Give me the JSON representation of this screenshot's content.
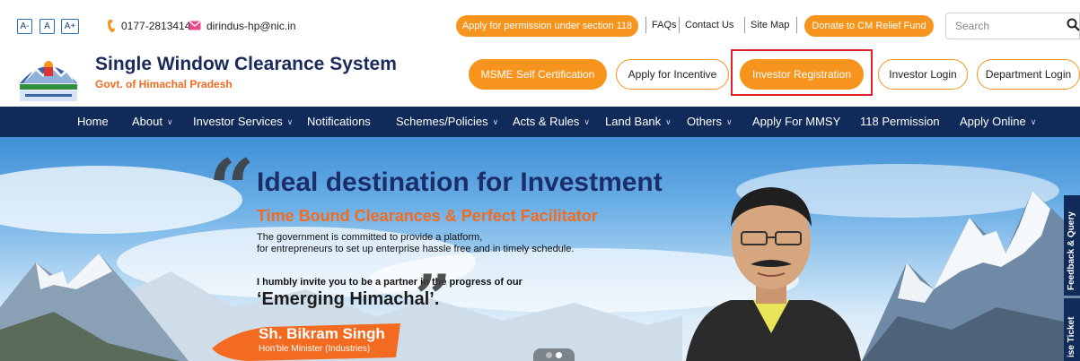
{
  "topbar": {
    "font_small": "A-",
    "font_normal": "A",
    "font_large": "A+",
    "phone": "0177-2813414",
    "email": "dirindus-hp@nic.in",
    "apply_permission": "Apply for permission under section 118",
    "faqs": "FAQs",
    "contact": "Contact Us",
    "sitemap": "Site Map",
    "donate": "Donate to CM Relief Fund",
    "search_placeholder": "Search"
  },
  "header": {
    "title": "Single Window Clearance System",
    "subtitle": "Govt. of Himachal Pradesh",
    "buttons": {
      "msme": "MSME Self Certification",
      "incentive": "Apply for Incentive",
      "investor_registration": "Investor Registration",
      "investor_login": "Investor Login",
      "department_login": "Department Login"
    }
  },
  "nav": {
    "home": "Home",
    "about": "About",
    "investor_services": "Investor Services",
    "notifications": "Notifications",
    "schemes": "Schemes/Policies",
    "acts": "Acts & Rules",
    "land_bank": "Land Bank",
    "others": "Others",
    "mmsy": "Apply For MMSY",
    "permission_118": "118 Permission",
    "apply_online": "Apply Online"
  },
  "hero": {
    "title": "Ideal destination for Investment",
    "subtitle": "Time Bound Clearances & Perfect Facilitator",
    "line1": "The government is committed to provide a platform,",
    "line2": "for entrepreneurs to set up enterprise hassle free and in timely schedule.",
    "invite": "I humbly invite you to be a partner in the progress of our",
    "emerging": "‘Emerging Himachal’.",
    "name": "Sh. Bikram Singh",
    "role": "Hon'ble Minister (Industries)"
  },
  "side_tabs": {
    "feedback": "Feedback & Query",
    "ticket": "ise Ticket"
  },
  "colors": {
    "accent_orange": "#f7941d",
    "nav_blue": "#102a5a",
    "title_blue": "#1b2a5a",
    "highlight_red": "#e0202a"
  }
}
